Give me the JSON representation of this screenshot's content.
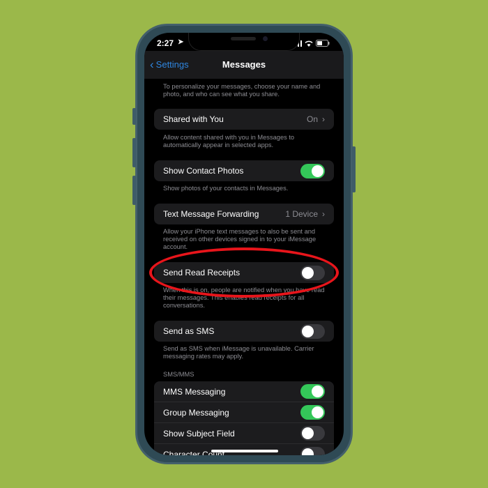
{
  "status": {
    "time": "2:27"
  },
  "nav": {
    "back_label": "Settings",
    "title": "Messages"
  },
  "top_footer": "To personalize your messages, choose your name and photo, and who can see what you share.",
  "rows": [
    {
      "label": "Shared with You",
      "value": "On",
      "footer": "Allow content shared with you in Messages to automatically appear in selected apps."
    },
    {
      "label": "Show Contact Photos",
      "toggle": true,
      "footer": "Show photos of your contacts in Messages."
    },
    {
      "label": "Text Message Forwarding",
      "value": "1 Device",
      "footer": "Allow your iPhone text messages to also be sent and received on other devices signed in to your iMessage account."
    },
    {
      "label": "Send Read Receipts",
      "toggle": false,
      "footer": "When this is on, people are notified when you have read their messages. This enables read receipts for all conversations."
    },
    {
      "label": "Send as SMS",
      "toggle": false,
      "footer": "Send as SMS when iMessage is unavailable. Carrier messaging rates may apply."
    }
  ],
  "sms_section": {
    "header": "SMS/MMS",
    "items": [
      {
        "label": "MMS Messaging",
        "toggle": true
      },
      {
        "label": "Group Messaging",
        "toggle": true
      },
      {
        "label": "Show Subject Field",
        "toggle": false
      },
      {
        "label": "Character Count",
        "toggle": false
      }
    ]
  },
  "colors": {
    "background": "#9bb84a",
    "toggle_on": "#34c759",
    "accent": "#2f86e0",
    "highlight_ring": "#e8151b"
  }
}
